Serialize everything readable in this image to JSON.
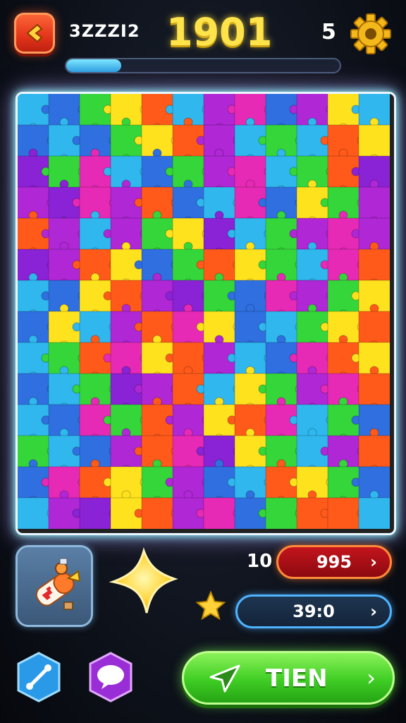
{
  "header": {
    "label": "3ZZZI2",
    "score": "1901",
    "count": "5",
    "progress": 0.2
  },
  "icons": {
    "back": "back-arrow-icon",
    "settings": "gear-icon",
    "item": "toolkit-icon",
    "star": "star-icon",
    "link": "link-icon",
    "chat": "chat-icon",
    "send": "paper-plane-icon"
  },
  "stats": {
    "left_number": "10",
    "coins": "995",
    "timer": "39:0"
  },
  "actions": {
    "go_label": "TIEN"
  },
  "colors": {
    "score": "#ffe34a",
    "go_button": "#3fcd24",
    "coins_pill": "#c4141c",
    "timer_pill": "#1e3550"
  },
  "board": {
    "columns": 12,
    "rows": 14,
    "palette": [
      "#2fb7ee",
      "#2f6fe0",
      "#35d63a",
      "#ffe21e",
      "#ff5a1a",
      "#b027d6",
      "#e62ab5",
      "#8a22d6"
    ],
    "grid": [
      "012340561530",
      "101234502043",
      "726012560247",
      "576541061325",
      "450523702565",
      "754312432064",
      "013457216523",
      "130546310234",
      "024634501643",
      "102754032564",
      "016245346021",
      "201546732054",
      "164325104321",
      "057345612440"
    ]
  }
}
